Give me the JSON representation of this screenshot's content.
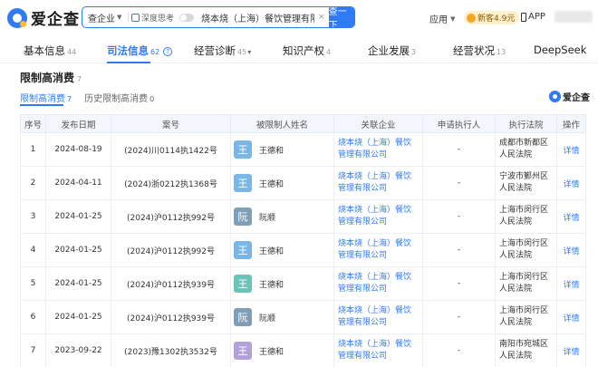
{
  "header": {
    "logo_text": "爱企查",
    "search_category": "查企业",
    "deep_think_label": "深度思考",
    "search_value": "烧本烧（上海）餐饮管理有限公司",
    "clear_symbol": "×",
    "search_button": "查一下",
    "apps_label": "应用",
    "vip_label": "新客4.9元",
    "app_link": "APP"
  },
  "main_tabs": [
    {
      "label": "基本信息",
      "count": "44"
    },
    {
      "label": "司法信息",
      "count": "62"
    },
    {
      "label": "经营诊断",
      "count": "45"
    },
    {
      "label": "知识产权",
      "count": "4"
    },
    {
      "label": "企业发展",
      "count": "3"
    },
    {
      "label": "经营状况",
      "count": "13"
    },
    {
      "label": "DeepSeek",
      "count": ""
    }
  ],
  "section": {
    "title": "限制高消费",
    "count": "7",
    "watermark": "爱企查"
  },
  "sub_tabs": [
    {
      "label": "限制高消费",
      "count": "7"
    },
    {
      "label": "历史限制高消费",
      "count": "0"
    }
  ],
  "table": {
    "headers": [
      "序号",
      "发布日期",
      "案号",
      "被限制人姓名",
      "关联企业",
      "申请执行人",
      "执行法院",
      "操作"
    ],
    "rows": [
      {
        "seq": "1",
        "date": "2024-08-19",
        "case": "(2024)川0114执1422号",
        "avatar_char": "王",
        "avatar_color": "blue",
        "name": "王德和",
        "company": "烧本烧（上海）餐饮管理有限公司",
        "applicant": "-",
        "court": "成都市新都区人民法院",
        "action": "详情"
      },
      {
        "seq": "2",
        "date": "2024-04-11",
        "case": "(2024)浙0212执1368号",
        "avatar_char": "王",
        "avatar_color": "blue",
        "name": "王德和",
        "company": "烧本烧（上海）餐饮管理有限公司",
        "applicant": "-",
        "court": "宁波市鄞州区人民法院",
        "action": "详情"
      },
      {
        "seq": "3",
        "date": "2024-01-25",
        "case": "(2024)沪0112执992号",
        "avatar_char": "阮",
        "avatar_color": "slate",
        "name": "阮顺",
        "company": "烧本烧（上海）餐饮管理有限公司",
        "applicant": "-",
        "court": "上海市闵行区人民法院",
        "action": "详情"
      },
      {
        "seq": "4",
        "date": "2024-01-25",
        "case": "(2024)沪0112执992号",
        "avatar_char": "王",
        "avatar_color": "blue",
        "name": "王德和",
        "company": "烧本烧（上海）餐饮管理有限公司",
        "applicant": "-",
        "court": "上海市闵行区人民法院",
        "action": "详情"
      },
      {
        "seq": "5",
        "date": "2024-01-25",
        "case": "(2024)沪0112执939号",
        "avatar_char": "王",
        "avatar_color": "teal",
        "name": "王德和",
        "company": "烧本烧（上海）餐饮管理有限公司",
        "applicant": "-",
        "court": "上海市闵行区人民法院",
        "action": "详情"
      },
      {
        "seq": "6",
        "date": "2024-01-25",
        "case": "(2024)沪0112执939号",
        "avatar_char": "阮",
        "avatar_color": "slate",
        "name": "阮顺",
        "company": "烧本烧（上海）餐饮管理有限公司",
        "applicant": "-",
        "court": "上海市闵行区人民法院",
        "action": "详情"
      },
      {
        "seq": "7",
        "date": "2023-09-22",
        "case": "(2023)豫1302执3532号",
        "avatar_char": "王",
        "avatar_color": "purple",
        "name": "王德和",
        "company": "烧本烧（上海）餐饮管理有限公司",
        "applicant": "-",
        "court": "南阳市宛城区人民法院",
        "action": "详情"
      }
    ]
  }
}
